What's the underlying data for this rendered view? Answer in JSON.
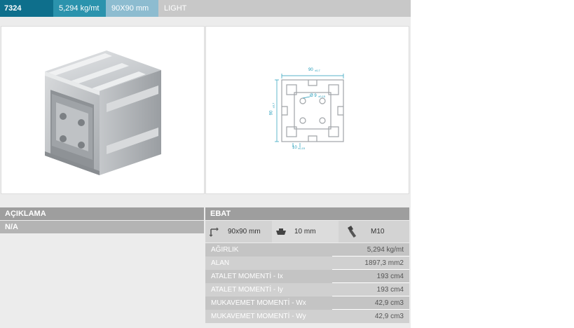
{
  "topbar": {
    "code": "7324",
    "weight": "5,294 kg/mt",
    "size": "90X90 mm",
    "type": "LIGHT"
  },
  "drawing": {
    "width_label": "90",
    "width_tol": "±0,7",
    "height_label": "90",
    "height_tol": "±0,7",
    "hole_label": "Ø 9",
    "hole_tol": "±0,15",
    "slot_label": "10",
    "slot_tol": "±0,15"
  },
  "left": {
    "header": "AÇIKLAMA",
    "value": "N/A"
  },
  "right": {
    "header": "EBAT",
    "dims": [
      {
        "icon": "profile-size-icon",
        "value": "90x90 mm"
      },
      {
        "icon": "slot-nut-icon",
        "value": "10 mm"
      },
      {
        "icon": "bolt-icon",
        "value": "M10"
      }
    ],
    "properties": [
      {
        "label": "AĞIRLIK",
        "value": "5,294 kg/mt"
      },
      {
        "label": "ALAN",
        "value": "1897,3 mm2"
      },
      {
        "label": "ATALET MOMENTİ - Ix",
        "value": "193 cm4"
      },
      {
        "label": "ATALET MOMENTİ - Iy",
        "value": "193 cm4"
      },
      {
        "label": "MUKAVEMET MOMENTİ - Wx",
        "value": "42,9 cm3"
      },
      {
        "label": "MUKAVEMET MOMENTİ - Wy",
        "value": "42,9 cm3"
      }
    ]
  },
  "colors": {
    "topbar_code": "#0e6f8c",
    "topbar_weight": "#2b93ad",
    "topbar_size": "#8dbcd0",
    "topbar_type": "#c8c8c8",
    "drawing_line": "#1f9ab8"
  }
}
